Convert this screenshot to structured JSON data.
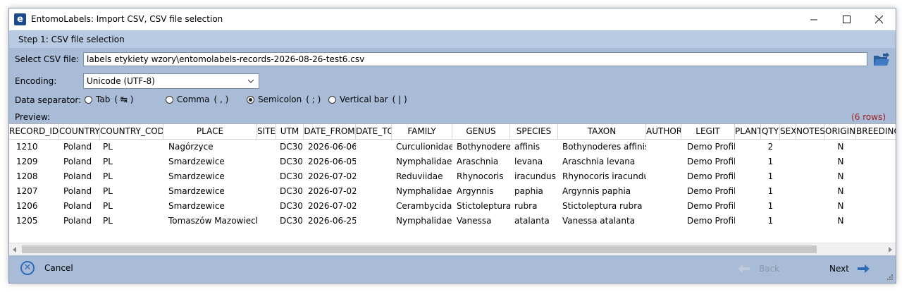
{
  "window": {
    "app_icon": "e",
    "title": "EntomoLabels: Import CSV, CSV file selection",
    "icons": [
      "minimize-icon",
      "maximize-icon",
      "close-icon"
    ]
  },
  "step": {
    "label": "Step 1: CSV file selection"
  },
  "form": {
    "file_label": "Select CSV file:",
    "file_value": "labels etykiety wzory\\entomolabels-records-2026-08-26-test6.csv",
    "encoding_label": "Encoding:",
    "encoding_value": "Unicode (UTF-8)",
    "separator_label": "Data separator:",
    "separators": [
      {
        "label": "Tab",
        "glyph": "( ↹ )",
        "selected": false
      },
      {
        "label": "Comma",
        "glyph": "( , )",
        "selected": false
      },
      {
        "label": "Semicolon",
        "glyph": "( ; )",
        "selected": true
      },
      {
        "label": "Vertical bar",
        "glyph": "( | )",
        "selected": false
      }
    ]
  },
  "preview": {
    "label": "Preview:",
    "rows_count": "(6 rows)",
    "columns": [
      "RECORD_ID",
      "COUNTRY",
      "COUNTRY_CODE",
      "PLACE",
      "SITE",
      "UTM",
      "DATE_FROM",
      "DATE_TO",
      "FAMILY",
      "GENUS",
      "SPECIES",
      "TAXON",
      "AUTHOR",
      "LEGIT",
      "PLANT",
      "QTY",
      "SEX",
      "NOTES",
      "ORIGIN",
      "BREEDING"
    ],
    "rows": [
      [
        "1210",
        "Poland",
        "PL",
        "Nagórzyce",
        "",
        "DC30",
        "2026-06-06",
        "",
        "Curculionidae",
        "Bothynoderes",
        "affinis",
        "Bothynoderes affinis",
        "",
        "Demo Profil",
        "",
        "2",
        "",
        "",
        "N",
        ""
      ],
      [
        "1209",
        "Poland",
        "PL",
        "Smardzewice",
        "",
        "DC30",
        "2026-06-05",
        "",
        "Nymphalidae",
        "Araschnia",
        "levana",
        "Araschnia levana",
        "",
        "Demo Profil",
        "",
        "1",
        "",
        "",
        "N",
        ""
      ],
      [
        "1208",
        "Poland",
        "PL",
        "Smardzewice",
        "",
        "DC30",
        "2026-07-02",
        "",
        "Reduviidae",
        "Rhynocoris",
        "iracundus",
        "Rhynocoris iracundus",
        "",
        "Demo Profil",
        "",
        "1",
        "",
        "",
        "N",
        ""
      ],
      [
        "1207",
        "Poland",
        "PL",
        "Smardzewice",
        "",
        "DC30",
        "2026-07-02",
        "",
        "Nymphalidae",
        "Argynnis",
        "paphia",
        "Argynnis paphia",
        "",
        "Demo Profil",
        "",
        "1",
        "",
        "",
        "N",
        ""
      ],
      [
        "1206",
        "Poland",
        "PL",
        "Smardzewice",
        "",
        "DC30",
        "2026-07-02",
        "",
        "Cerambycidae",
        "Stictoleptura",
        "rubra",
        "Stictoleptura rubra",
        "",
        "Demo Profil",
        "",
        "1",
        "",
        "",
        "N",
        ""
      ],
      [
        "1205",
        "Poland",
        "PL",
        "Tomaszów Mazowiecki",
        "",
        "DC30",
        "2026-06-25",
        "",
        "Nymphalidae",
        "Vanessa",
        "atalanta",
        "Vanessa atalanta",
        "",
        "Demo Profil",
        "",
        "1",
        "",
        "",
        "N",
        ""
      ]
    ]
  },
  "footer": {
    "cancel_label": "Cancel",
    "back_label": "Back",
    "next_label": "Next"
  },
  "colors": {
    "panel": "#a8bcd8",
    "step_bar": "#b8c9e2",
    "accent": "#2e6bb5",
    "rows_count": "#a02020"
  }
}
